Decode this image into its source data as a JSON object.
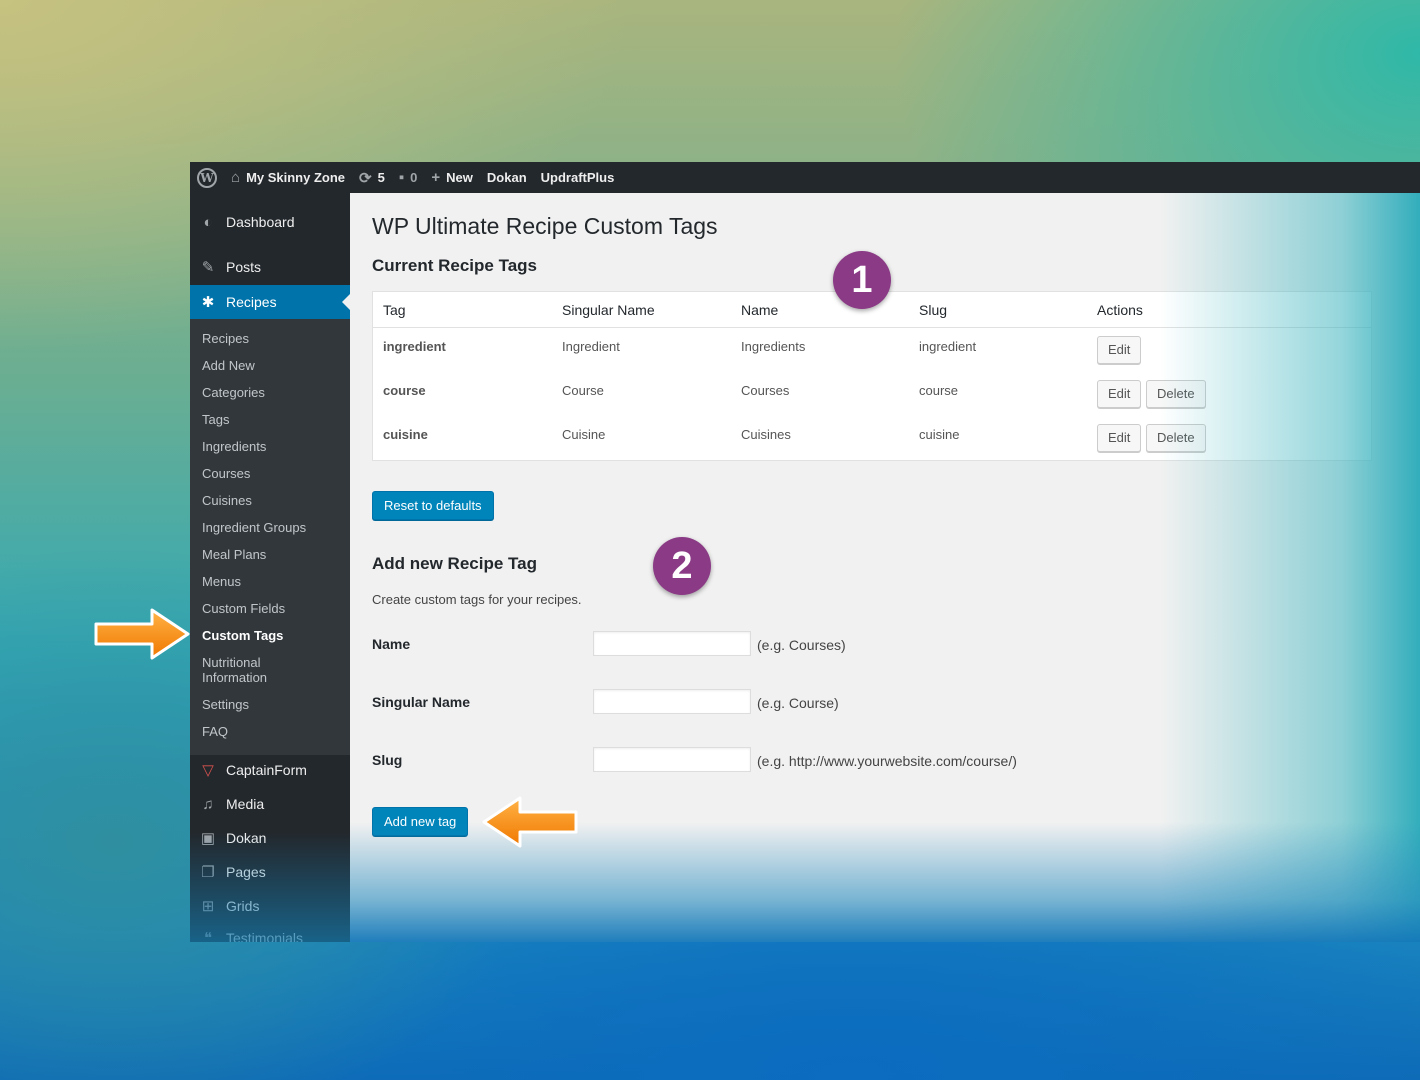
{
  "adminbar": {
    "site_name": "My Skinny Zone",
    "updates_count": "5",
    "comments_count": "0",
    "new_label": "New",
    "dokan_label": "Dokan",
    "updraft_label": "UpdraftPlus"
  },
  "sidebar": {
    "dashboard": "Dashboard",
    "posts": "Posts",
    "recipes": "Recipes",
    "submenu": [
      "Recipes",
      "Add New",
      "Categories",
      "Tags",
      "Ingredients",
      "Courses",
      "Cuisines",
      "Ingredient Groups",
      "Meal Plans",
      "Menus",
      "Custom Fields",
      "Custom Tags",
      "Nutritional Information",
      "Settings",
      "FAQ"
    ],
    "captainform": "CaptainForm",
    "media": "Media",
    "dokan": "Dokan",
    "pages": "Pages",
    "grids": "Grids",
    "testimonials": "Testimonials"
  },
  "main": {
    "title": "WP Ultimate Recipe Custom Tags",
    "current_heading": "Current Recipe Tags",
    "table": {
      "headers": [
        "Tag",
        "Singular Name",
        "Name",
        "Slug",
        "Actions"
      ],
      "rows": [
        {
          "tag": "ingredient",
          "singular": "Ingredient",
          "name": "Ingredients",
          "slug": "ingredient"
        },
        {
          "tag": "course",
          "singular": "Course",
          "name": "Courses",
          "slug": "course"
        },
        {
          "tag": "cuisine",
          "singular": "Cuisine",
          "name": "Cuisines",
          "slug": "cuisine"
        }
      ],
      "edit_label": "Edit",
      "delete_label": "Delete"
    },
    "reset_label": "Reset to defaults",
    "add_heading": "Add new Recipe Tag",
    "add_desc": "Create custom tags for your recipes.",
    "fields": [
      {
        "label": "Name",
        "hint": "(e.g. Courses)"
      },
      {
        "label": "Singular Name",
        "hint": "(e.g. Course)"
      },
      {
        "label": "Slug",
        "hint": "(e.g. http://www.yourwebsite.com/course/)"
      }
    ],
    "add_button": "Add new tag"
  },
  "annotations": {
    "badge1": "1",
    "badge2": "2",
    "arrow_color": "#f7941d",
    "badge_color": "#8b3a86"
  }
}
